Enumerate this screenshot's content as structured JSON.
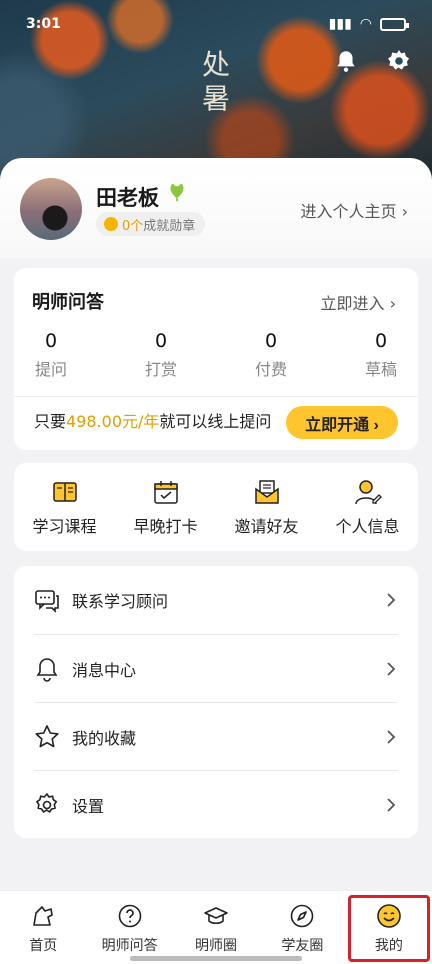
{
  "status_bar": {
    "time": "3:01",
    "battery": "99"
  },
  "banner": {
    "calligraphy": "处暑"
  },
  "profile": {
    "name": "田老板",
    "badge_count": "0个",
    "badge_label": "成就勋章",
    "enter_home": "进入个人主页 ›"
  },
  "qa": {
    "title": "明师问答",
    "enter": "立即进入 ›",
    "stats": [
      {
        "value": "0",
        "label": "提问"
      },
      {
        "value": "0",
        "label": "打赏"
      },
      {
        "value": "0",
        "label": "付费"
      },
      {
        "value": "0",
        "label": "草稿"
      }
    ],
    "promo_prefix": "只要",
    "promo_price": "498.00元/年",
    "promo_suffix": "就可以线上提问",
    "open_button": "立即开通 ›"
  },
  "actions": [
    {
      "label": "学习课程",
      "icon": "book-icon"
    },
    {
      "label": "早晚打卡",
      "icon": "calendar-check-icon"
    },
    {
      "label": "邀请好友",
      "icon": "envelope-icon"
    },
    {
      "label": "个人信息",
      "icon": "user-edit-icon"
    }
  ],
  "menu": [
    {
      "label": "联系学习顾问",
      "icon": "chat-icon"
    },
    {
      "label": "消息中心",
      "icon": "bell-icon"
    },
    {
      "label": "我的收藏",
      "icon": "star-icon"
    },
    {
      "label": "设置",
      "icon": "gear-icon"
    }
  ],
  "bottom_nav": [
    {
      "label": "首页",
      "icon": "home-icon"
    },
    {
      "label": "明师问答",
      "icon": "question-icon"
    },
    {
      "label": "明师圈",
      "icon": "graduation-cap-icon"
    },
    {
      "label": "学友圈",
      "icon": "compass-icon"
    },
    {
      "label": "我的",
      "icon": "smiley-icon",
      "active": true
    }
  ],
  "colors": {
    "accent": "#fec52e",
    "price": "#e0a000",
    "highlight": "#d8222a"
  }
}
